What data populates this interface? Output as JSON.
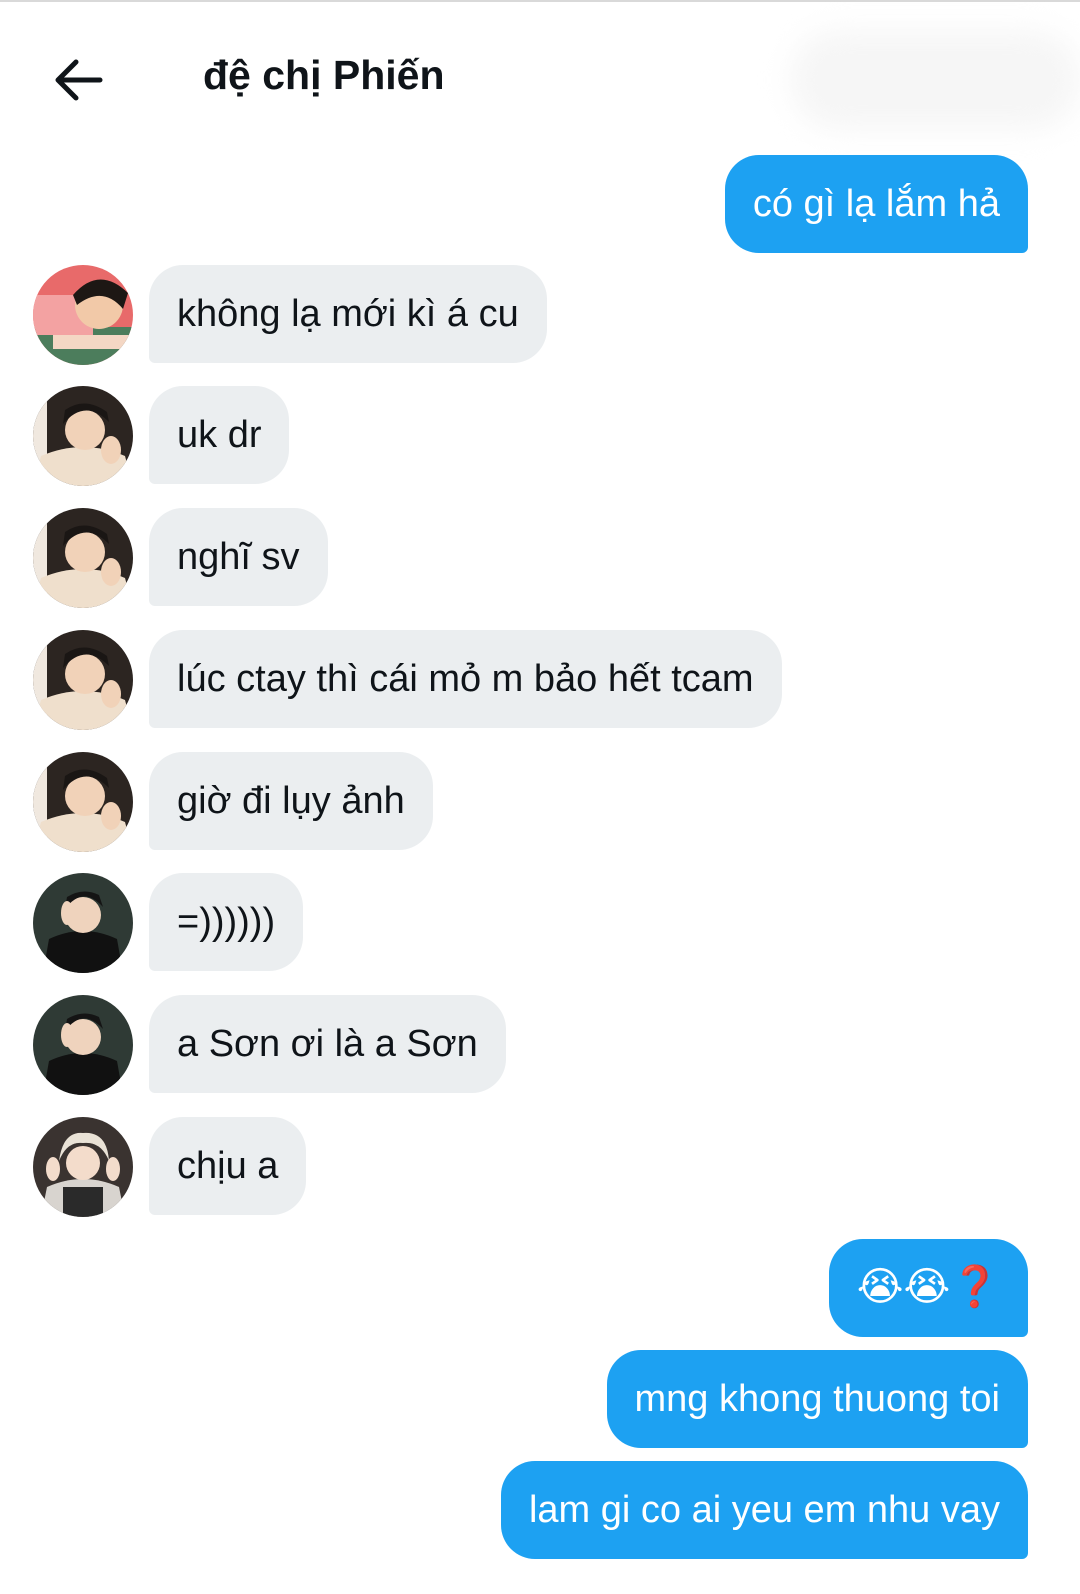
{
  "header": {
    "title": "đệ chị Phiến",
    "back_icon": "arrow-left-icon"
  },
  "colors": {
    "outgoing": "#1da1f2",
    "incoming": "#ebeef0",
    "text_dark": "#0f1419"
  },
  "messages": [
    {
      "dir": "out",
      "text": "có gì lạ lắm hả"
    },
    {
      "dir": "in",
      "avatar": "avatar-pink-sweater",
      "text": "không lạ mới kì á cu"
    },
    {
      "dir": "in",
      "avatar": "avatar-cream-sweater",
      "text": "uk dr"
    },
    {
      "dir": "in",
      "avatar": "avatar-cream-sweater",
      "text": "nghĩ sv"
    },
    {
      "dir": "in",
      "avatar": "avatar-cream-sweater",
      "text": "lúc ctay thì cái mỏ m bảo hết tcam"
    },
    {
      "dir": "in",
      "avatar": "avatar-cream-sweater",
      "text": "giờ đi lụy ảnh"
    },
    {
      "dir": "in",
      "avatar": "avatar-black-jacket",
      "text": "=))))))"
    },
    {
      "dir": "in",
      "avatar": "avatar-black-jacket",
      "text": "a Sơn ơi là a Sơn"
    },
    {
      "dir": "in",
      "avatar": "avatar-blonde-hair",
      "text": "chịu a"
    },
    {
      "dir": "out",
      "text": "😭😭❓"
    },
    {
      "dir": "out",
      "text": "mng khong thuong toi"
    },
    {
      "dir": "out",
      "text": "lam gi co ai yeu em nhu vay"
    }
  ]
}
